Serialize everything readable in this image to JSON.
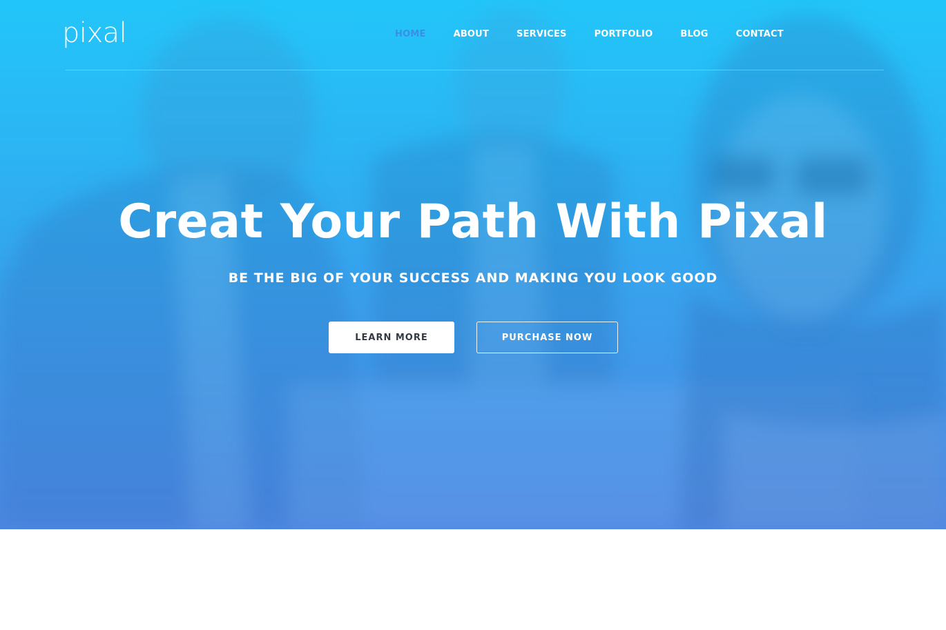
{
  "brand": {
    "logo_text": "pixal"
  },
  "nav": {
    "items": [
      {
        "label": "HOME",
        "active": true
      },
      {
        "label": "ABOUT",
        "active": false
      },
      {
        "label": "SERVICES",
        "active": false
      },
      {
        "label": "PORTFOLIO",
        "active": false
      },
      {
        "label": "BLOG",
        "active": false
      },
      {
        "label": "CONTACT",
        "active": false
      }
    ]
  },
  "hero": {
    "title": "Creat Your Path With Pixal",
    "subtitle": "BE THE BIG OF YOUR SUCCESS AND MAKING YOU LOOK GOOD",
    "primary_button": "LEARN MORE",
    "secondary_button": "PURCHASE NOW",
    "background_image": "blurred-office-team-photo"
  },
  "colors": {
    "hero_gradient_top": "#22c4f8",
    "hero_gradient_bottom": "#5088e4",
    "nav_active": "#3a8ee6",
    "button_primary_bg": "#ffffff",
    "button_primary_text": "#333a45",
    "page_background": "#ffffff"
  }
}
